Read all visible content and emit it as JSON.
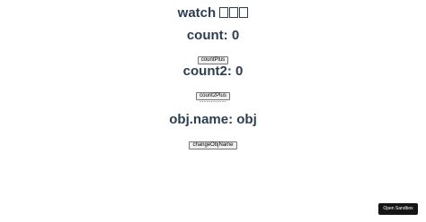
{
  "title": {
    "text": "watch",
    "glyphs": [
      "",
      "",
      ""
    ]
  },
  "count": {
    "label": "count: 0",
    "button_label": "countPlus"
  },
  "count2": {
    "label": "count2: 0",
    "button_label": "count2Plus"
  },
  "separator": "------------",
  "obj": {
    "label": "obj.name: obj",
    "button_label": "changeObjName"
  },
  "sandbox": {
    "button_label": "Open Sandbox"
  },
  "colors": {
    "text": "#2c3e50",
    "sandbox_bg": "#151515",
    "sandbox_text": "#ffffff"
  }
}
